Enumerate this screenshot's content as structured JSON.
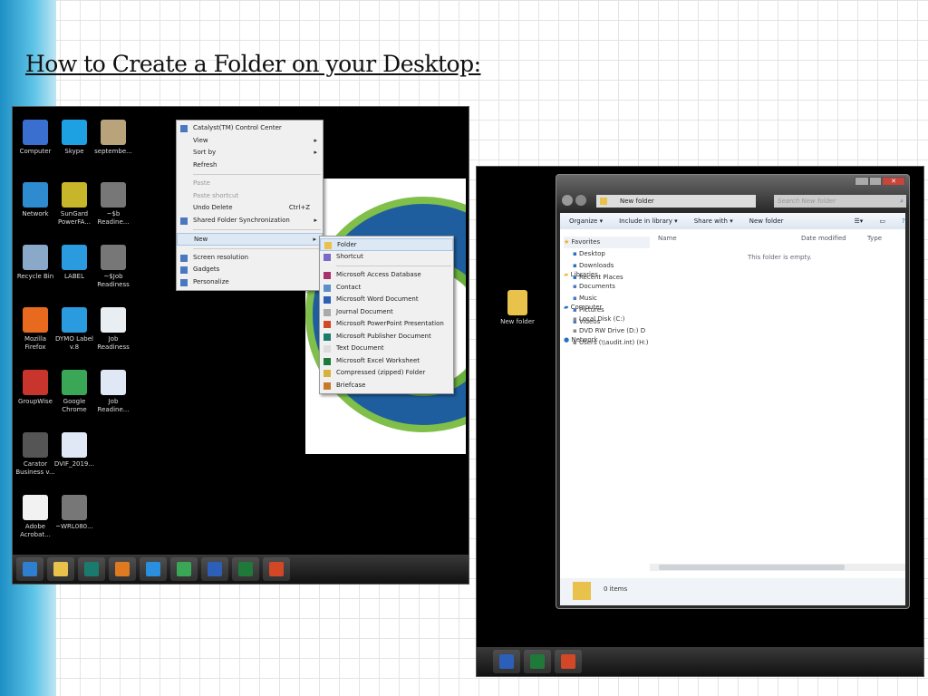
{
  "slide": {
    "title": "How to Create a Folder on your Desktop:"
  },
  "desktop": {
    "icons": [
      {
        "label": "Computer",
        "color": "#3a6fd0"
      },
      {
        "label": "Skype",
        "color": "#1da1e2"
      },
      {
        "label": "septembe...",
        "color": "#b9a37a"
      },
      {
        "label": "Network",
        "color": "#2e8bd0"
      },
      {
        "label": "SunGard PowerFA...",
        "color": "#c7b52a"
      },
      {
        "label": "~$b Readine...",
        "color": "#777"
      },
      {
        "label": "Recycle Bin",
        "color": "#8aa8c8"
      },
      {
        "label": "LABEL",
        "color": "#2b9be0"
      },
      {
        "label": "~$Job Readiness",
        "color": "#777"
      },
      {
        "label": "Mozilla Firefox",
        "color": "#e86a1f"
      },
      {
        "label": "DYMO Label v.8",
        "color": "#2b9be0"
      },
      {
        "label": "Job Readiness",
        "color": "#e9eef2"
      },
      {
        "label": "GroupWise",
        "color": "#c8352c"
      },
      {
        "label": "Google Chrome",
        "color": "#3aa757"
      },
      {
        "label": "Job Readine...",
        "color": "#dfe8f4"
      },
      {
        "label": "Carator Business v...",
        "color": "#555"
      },
      {
        "label": "DVIF_2019...",
        "color": "#dfe8f4"
      },
      {
        "label": "Adobe Acrobat...",
        "color": "#f2f2f2"
      },
      {
        "label": "~WRL080...",
        "color": "#777"
      }
    ]
  },
  "context_menu": {
    "items": [
      {
        "label": "Catalyst(TM) Control Center",
        "icon": "catalyst-icon"
      },
      {
        "label": "View",
        "arrow": true
      },
      {
        "label": "Sort by",
        "arrow": true
      },
      {
        "label": "Refresh"
      },
      {
        "sep": true
      },
      {
        "label": "Paste",
        "disabled": true
      },
      {
        "label": "Paste shortcut",
        "disabled": true
      },
      {
        "label": "Undo Delete",
        "shortcut": "Ctrl+Z"
      },
      {
        "label": "Shared Folder Synchronization",
        "arrow": true,
        "icon": "sync-icon"
      },
      {
        "sep": true
      },
      {
        "label": "New",
        "arrow": true,
        "highlight": true
      },
      {
        "sep": true
      },
      {
        "label": "Screen resolution",
        "icon": "screen-icon"
      },
      {
        "label": "Gadgets",
        "icon": "gadgets-icon"
      },
      {
        "label": "Personalize",
        "icon": "personalize-icon"
      }
    ]
  },
  "new_submenu": {
    "items": [
      {
        "label": "Folder",
        "color": "#e8c24a",
        "highlight": true
      },
      {
        "label": "Shortcut",
        "color": "#7a6ac9"
      },
      {
        "sep": true
      },
      {
        "label": "Microsoft Access Database",
        "color": "#a8326e"
      },
      {
        "label": "Contact",
        "color": "#5a8fc9"
      },
      {
        "label": "Microsoft Word Document",
        "color": "#2b5fb8"
      },
      {
        "label": "Journal Document",
        "color": "#aaa"
      },
      {
        "label": "Microsoft PowerPoint Presentation",
        "color": "#d24726"
      },
      {
        "label": "Microsoft Publisher Document",
        "color": "#1b7a6e"
      },
      {
        "label": "Text Document",
        "color": "#ddd"
      },
      {
        "label": "Microsoft Excel Worksheet",
        "color": "#1f7a3a"
      },
      {
        "label": "Compressed (zipped) Folder",
        "color": "#d9b13a"
      },
      {
        "label": "Briefcase",
        "color": "#c77a2a"
      }
    ]
  },
  "taskbar_left": [
    {
      "name": "start-icon",
      "color": "#2f7fd0"
    },
    {
      "name": "explorer-icon",
      "color": "#e8c24a"
    },
    {
      "name": "publisher-icon",
      "color": "#1b7a6e"
    },
    {
      "name": "media-player-icon",
      "color": "#e07a20"
    },
    {
      "name": "ie-icon",
      "color": "#2b8fe0"
    },
    {
      "name": "chrome-icon",
      "color": "#3aa757"
    },
    {
      "name": "word-icon",
      "color": "#2b5fb8"
    },
    {
      "name": "excel-icon",
      "color": "#1f7a3a"
    },
    {
      "name": "powerpoint-icon",
      "color": "#d24726"
    }
  ],
  "taskbar_right": [
    {
      "name": "word-icon",
      "color": "#2b5fb8"
    },
    {
      "name": "excel-icon",
      "color": "#1f7a3a"
    },
    {
      "name": "powerpoint-icon",
      "color": "#d24726"
    }
  ],
  "new_folder_icon": {
    "label": "New folder"
  },
  "explorer": {
    "address": "New folder",
    "search_placeholder": "Search New folder",
    "toolbar": {
      "organize": "Organize ▾",
      "include": "Include in library ▾",
      "share": "Share with ▾",
      "new_folder": "New folder"
    },
    "columns": {
      "name": "Name",
      "date": "Date modified",
      "type": "Type"
    },
    "empty_text": "This folder is empty.",
    "nav": {
      "favorites": "Favorites",
      "fav_items": [
        "Desktop",
        "Downloads",
        "Recent Places"
      ],
      "libraries": "Libraries",
      "lib_items": [
        "Documents",
        "Music",
        "Pictures",
        "Videos"
      ],
      "computer": "Computer",
      "comp_items": [
        "Local Disk (C:)",
        "DVD RW Drive (D:) D",
        "Users (\\\\audit.int) (H:)"
      ],
      "network": "Network"
    },
    "status": "0 items"
  }
}
